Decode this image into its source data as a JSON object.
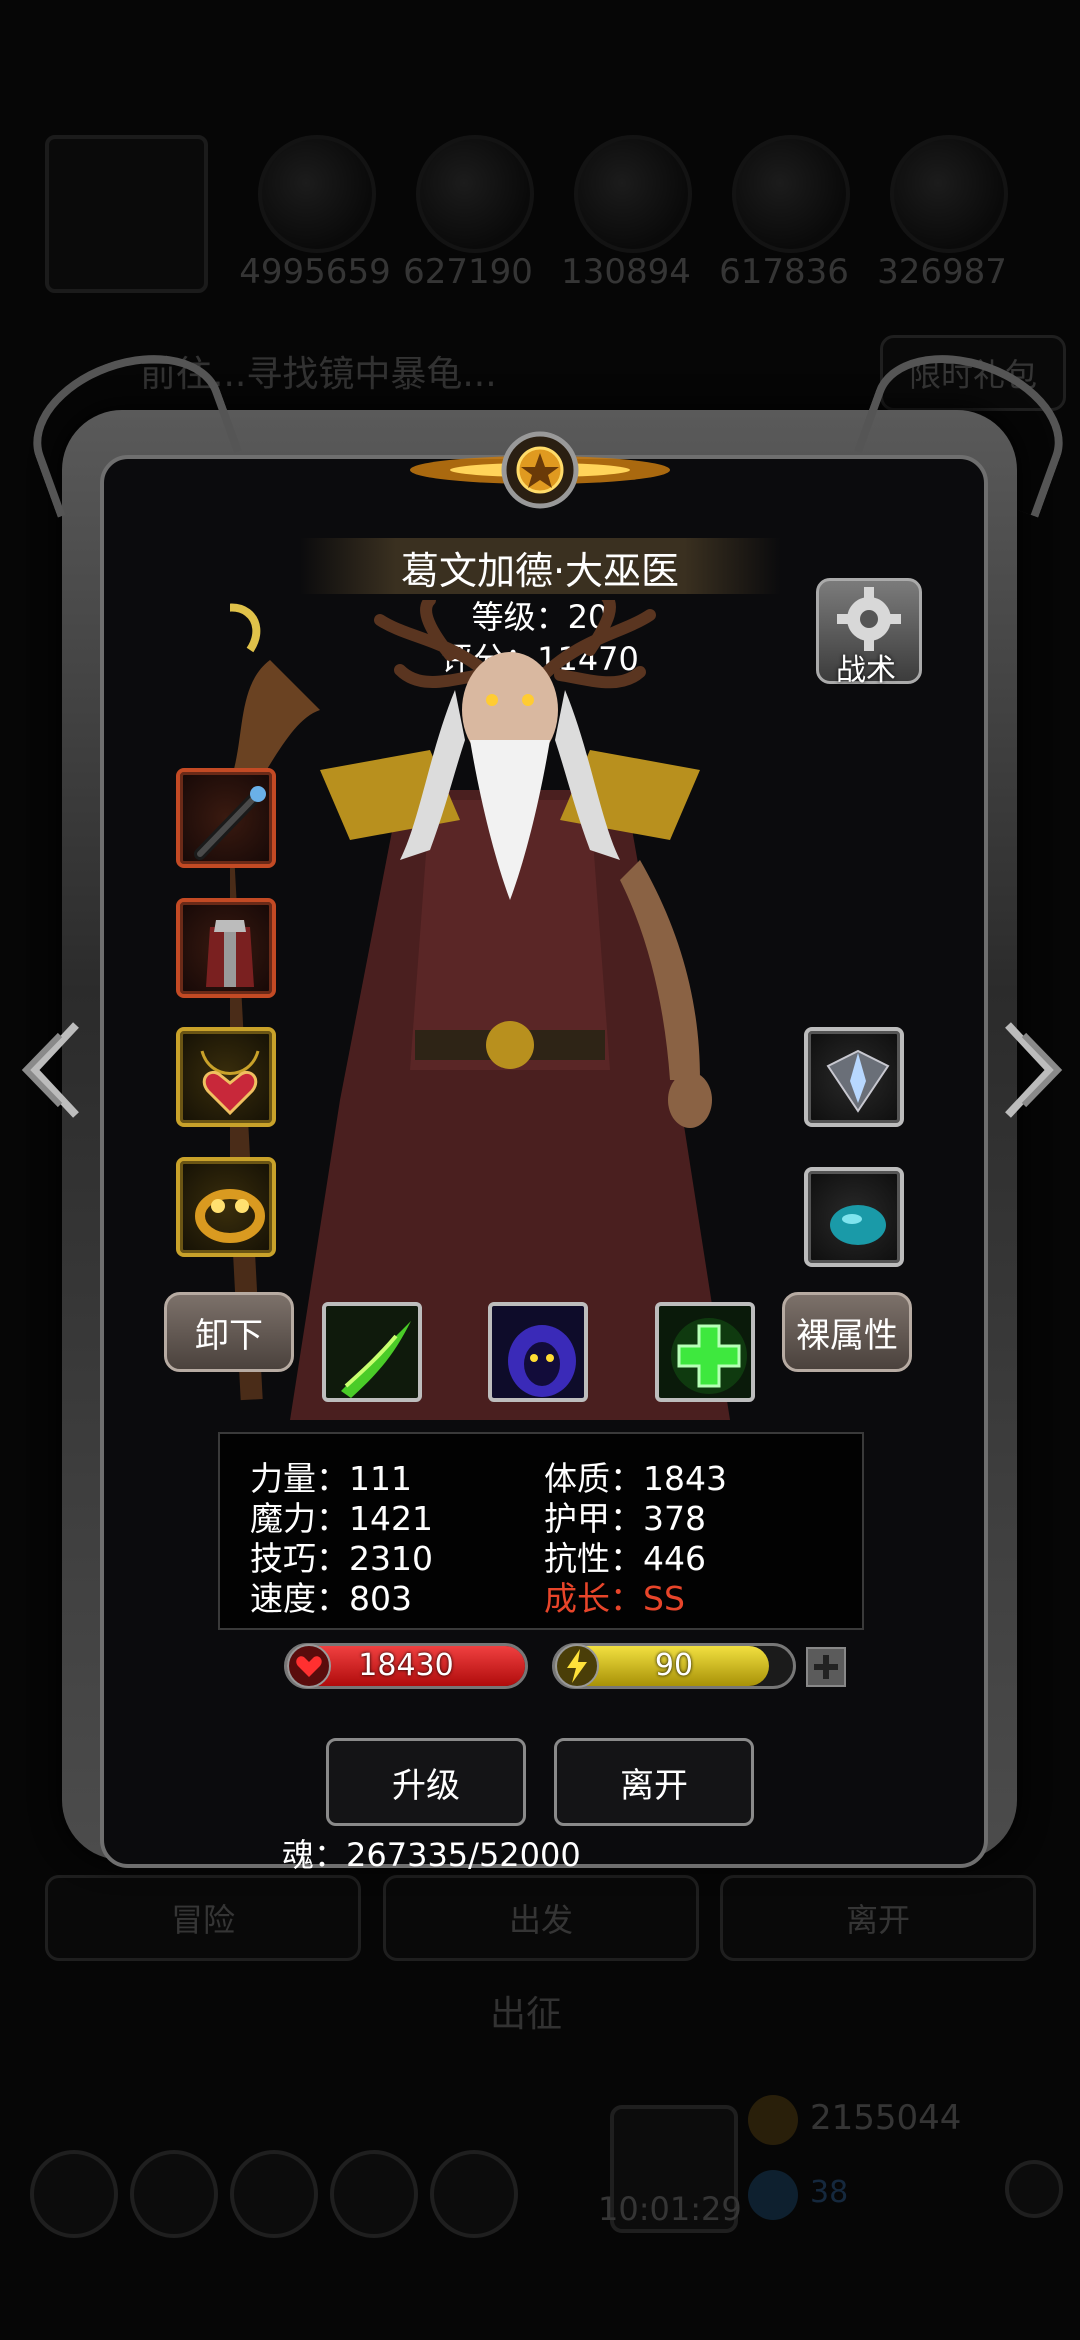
{
  "background": {
    "resources": [
      "4995659",
      "627190",
      "130894",
      "617836",
      "326987"
    ],
    "banner_text": "前往...寻找镜中暴龟...",
    "limited_pack": "限时礼包",
    "nav_buttons": [
      "冒险",
      "出发",
      "离开"
    ],
    "section_title": "出征",
    "clock": "10:01:29",
    "gold_count": "2155044",
    "gem_count": "38"
  },
  "hero": {
    "name": "葛文加德·大巫医",
    "level_line": "等级：20",
    "score_line": "评分：11470"
  },
  "tactic_label": "战术",
  "buttons": {
    "unequip": "卸下",
    "base_attributes": "裸属性",
    "upgrade": "升级",
    "leave": "离开"
  },
  "stats": {
    "strength": "力量：111",
    "magic": "魔力：1421",
    "skill": "技巧：2310",
    "speed": "速度：803",
    "constitution": "体质：1843",
    "armor": "护甲：378",
    "resistance": "抗性：446",
    "growth_label": "成长：",
    "growth_value": "SS"
  },
  "bars": {
    "hp": "18430",
    "hp_fill": 1.0,
    "energy": "90",
    "energy_fill": 0.9
  },
  "soul_text": "魂：267335/52000",
  "colors": {
    "growth": "#e8452a",
    "hp": "#d41818",
    "energy": "#d8c21a"
  }
}
